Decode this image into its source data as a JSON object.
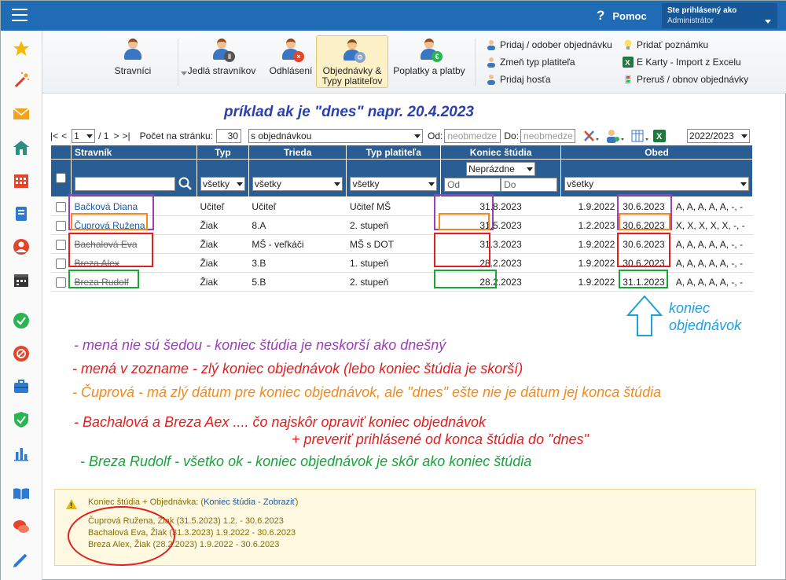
{
  "header": {
    "help_label": "Pomoc",
    "help_icon": "?",
    "user_line1": "Ste prihlásený ako",
    "user_line2": "Administrátor"
  },
  "toolbar": {
    "buttons": [
      "Stravníci",
      "Jedlá stravníkov",
      "Odhlásení",
      "Objednávky &",
      "Typy platiteľov",
      "Poplatky a platby"
    ],
    "links": [
      "Pridaj / odober objednávku",
      "Zmeň typ platiteľa",
      "Pridaj hosťa",
      "Pridať poznámku",
      "E Karty - Import z Excelu",
      "Preruš / obnov objednávky"
    ]
  },
  "annotation_title": "príklad ak je \"dnes\" napr. 20.4.2023",
  "pager": {
    "first": "|<",
    "prev": "<",
    "page": "1",
    "of": "/ 1",
    "next": ">",
    "last": ">|",
    "per_page_label": "Počet na stránku:",
    "per_page": "30",
    "filter": "s objednávkou",
    "from_label": "Od:",
    "to_label": "Do:",
    "date_placeholder": "neobmedze",
    "year": "2022/2023"
  },
  "table": {
    "headers": [
      "Stravník",
      "Typ",
      "Trieda",
      "Typ platiteľa",
      "Koniec štúdia",
      "Obed"
    ],
    "filters": {
      "typ": "všetky",
      "trieda": "všetky",
      "platitel": "všetky",
      "koniec": "Neprázdne",
      "od": "Od",
      "do": "Do",
      "obed": "všetky"
    },
    "rows": [
      {
        "name": "Bačková Diana",
        "typ": "Učiteľ",
        "trieda": "Učiteľ",
        "platitel": "Učiteľ MŠ",
        "koniec": "31.8.2023",
        "od": "1.9.2022",
        "do": "30.6.2023",
        "days": "A, A, A, A, A, -, -"
      },
      {
        "name": "Čuprová Ružena",
        "typ": "Žiak",
        "trieda": "8.A",
        "platitel": "2. stupeň",
        "koniec": "31.5.2023",
        "od": "1.2.2023",
        "do": "30.6.2023",
        "days": "X, X, X, X, X, -, -"
      },
      {
        "name": "Bachalová Eva",
        "typ": "Žiak",
        "trieda": "MŠ - veľkáči",
        "platitel": "MŠ s DOT",
        "koniec": "31.3.2023",
        "od": "1.9.2022",
        "do": "30.6.2023",
        "days": "A, A, A, A, A, -, -"
      },
      {
        "name": "Breza Alex",
        "typ": "Žiak",
        "trieda": "3.B",
        "platitel": "1. stupeň",
        "koniec": "28.2.2023",
        "od": "1.9.2022",
        "do": "30.6.2023",
        "days": "A, A, A, A, A, -, -"
      },
      {
        "name": "Breza Rudolf",
        "typ": "Žiak",
        "trieda": "5.B",
        "platitel": "2. stupeň",
        "koniec": "28.2.2023",
        "od": "1.9.2022",
        "do": "31.1.2023",
        "days": "A, A, A, A, A, -, -"
      }
    ]
  },
  "arrow_label1": "koniec",
  "arrow_label2": "objednávok",
  "notes": [
    "- mená nie sú šedou - koniec štúdia je neskorší ako dnešný",
    "- mená v zozname -  zlý koniec objednávok  (lebo koniec štúdia je skorší)",
    "- Čuprová - má zlý dátum pre koniec objednávok, ale \"dnes\" ešte nie je dátum jej konca štúdia",
    "- Bachalová a Breza Aex ....  čo najskôr opraviť koniec objednávok",
    "+ preveriť prihlásené od konca štúdia do \"dnes\"",
    "- Breza Rudolf - všetko ok - koniec objednávok je skôr ako koniec štúdia"
  ],
  "warning": {
    "title_pre": "Koniec štúdia + Objednávka: (",
    "title_link": "Koniec štúdia - Zobraziť",
    "title_post": ")",
    "lines": [
      "Čuprová Ružena, Žiak (31.5.2023) 1.2. - 30.6.2023",
      "Bachalová Eva, Žiak (31.3.2023) 1.9.2022 - 30.6.2023",
      "Breza Alex, Žiak (28.2.2023) 1.9.2022 - 30.6.2023"
    ]
  },
  "colors": {
    "purple": "#9b3fb5",
    "orange": "#f08a1c",
    "red": "#e02020",
    "green": "#1aa33a",
    "blue": "#1ea0e0"
  }
}
